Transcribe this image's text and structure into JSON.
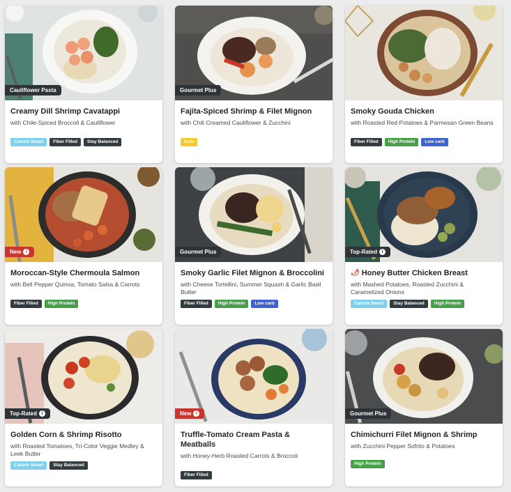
{
  "colors": {
    "tag_calorie_smart": "#7dd0ee",
    "tag_dark": "#323b40",
    "tag_high_protein": "#45a148",
    "tag_low_carb": "#3c63cf",
    "tag_keto": "#f3c92e",
    "ribbon_dark": "#2d3336",
    "ribbon_new": "#c8372f"
  },
  "cards": [
    {
      "ribbon": "Cauliflower Pasta",
      "title": "Creamy Dill Shrimp Cavatappi",
      "subtitle": "with Chile-Spiced Broccoli & Cauliflower",
      "tags": [
        "Calorie Smart",
        "Fiber Filled",
        "Stay Balanced"
      ]
    },
    {
      "ribbon": "Gourmet Plus",
      "title": "Fajita-Spiced Shrimp & Filet Mignon",
      "subtitle": "with Chili Creamed Cauliflower & Zucchini",
      "tags": [
        "Keto"
      ]
    },
    {
      "ribbon": "",
      "title": "Smoky Gouda Chicken",
      "subtitle": "with Roasted Red Potatoes & Parmesan Green Beans",
      "tags": [
        "Fiber Filled",
        "High Protein",
        "Low carb"
      ]
    },
    {
      "ribbon": "New",
      "title": "Moroccan-Style Chermoula Salmon",
      "subtitle": "with Bell Pepper Quinoa, Tomato Salsa & Carrots",
      "tags": [
        "Fiber Filled",
        "High Protein"
      ]
    },
    {
      "ribbon": "Gourmet Plus",
      "title": "Smoky Garlic Filet Mignon & Broccolini",
      "subtitle": "with Cheese Tortellini, Summer Squash & Garlic Basil Butter",
      "tags": [
        "Fiber Filled",
        "High Protein",
        "Low carb"
      ]
    },
    {
      "ribbon": "Top-Rated",
      "title": "Honey Butter Chicken Breast",
      "subtitle": "with Mashed Potatoes, Roasted Zucchini & Caramelized Onions",
      "tags": [
        "Calorie Smart",
        "Stay Balanced",
        "High Protein"
      ]
    },
    {
      "ribbon": "Top-Rated",
      "title": "Golden Corn & Shrimp Risotto",
      "subtitle": "with Roasted Tomatoes, Tri-Color Veggie Medley & Leek Butter",
      "tags": [
        "Calorie Smart",
        "Stay Balanced"
      ]
    },
    {
      "ribbon": "New",
      "title": "Truffle-Tomato Cream Pasta & Meatballs",
      "subtitle": "with Honey-Herb Roasted Carrots & Broccoli",
      "tags": [
        "Fiber Filled"
      ]
    },
    {
      "ribbon": "Gourmet Plus",
      "title": "Chimichurri Filet Mignon & Shrimp",
      "subtitle": "with Zucchini Pepper Sofrito & Potatoes",
      "tags": [
        "High Protein"
      ]
    }
  ]
}
